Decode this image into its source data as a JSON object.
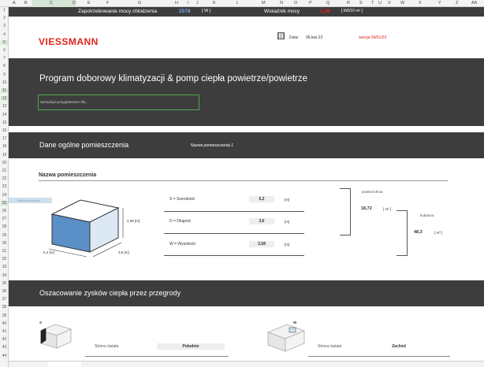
{
  "columns": [
    "A",
    "B",
    "C",
    "D",
    "E",
    "F",
    "G",
    "H",
    "I",
    "J",
    "K",
    "L",
    "M",
    "N",
    "O",
    "P",
    "Q",
    "R",
    "S",
    "T",
    "U",
    "V",
    "W",
    "X",
    "Y",
    "Z",
    "AA"
  ],
  "rows": [
    "1",
    "2",
    "3",
    "4",
    "5",
    "6",
    "7",
    "8",
    "9",
    "10",
    "11",
    "12",
    "13",
    "14",
    "15",
    "16",
    "17",
    "18",
    "19",
    "20",
    "21",
    "22",
    "23",
    "24",
    "25",
    "26",
    "27",
    "28",
    "29",
    "30",
    "31",
    "32",
    "33",
    "34",
    "35",
    "36",
    "37",
    "38",
    "39",
    "40",
    "41",
    "42",
    "43",
    "44"
  ],
  "topbar": {
    "demand_label": "Zapotrzebowanie mocy chłodzenia",
    "demand_value": "2578",
    "demand_unit": "[ W ]",
    "index_label": "Wskaźnik mocy",
    "index_value": "1,36",
    "index_unit": "[ kW/10 m² ]"
  },
  "header": {
    "logo": "VIESSMANN",
    "date_label": "Data:",
    "date_value": "06.kwi.23",
    "version": "wersja 04/01/23"
  },
  "banner": {
    "title": "Program doborowy klimatyzacji & pomp ciepła powietrze/powietrze",
    "sim_placeholder": "Symulacja przygotowano dla..."
  },
  "general": {
    "heading": "Dane ogólne pomieszczenia",
    "room_name_value": "Nazwa pomieszczenia 1"
  },
  "room": {
    "title": "Nazwa pomieszczenia",
    "side_label": "Naciśnij przycisk",
    "box_height": "2,58 [m]",
    "box_width": "5,2 [m]",
    "box_depth": "3,6 [m]",
    "dims": [
      {
        "label": "S = Szerokość",
        "value": "5,2",
        "unit": "[m]"
      },
      {
        "label": "D = Długość",
        "value": "3,6",
        "unit": "[m]"
      },
      {
        "label": "W = Wysokość",
        "value": "2,58",
        "unit": "[m]"
      }
    ],
    "area_label": "powierzchnia",
    "area_value": "18,72",
    "area_unit": "[ m² ]",
    "volume_label": "kubatura",
    "volume_value": "48,3",
    "volume_unit": "[ m³ ]"
  },
  "gains": {
    "heading": "Oszacowanie zysków ciepła przez przegrody",
    "walls": [
      {
        "letter": "S",
        "strona_label": "Strona świata",
        "value": "Południe"
      },
      {
        "letter": "W",
        "strona_label": "Strona świata",
        "value": "Zachód"
      }
    ]
  },
  "colors": {
    "dark": "#3d3d3d",
    "brand_red": "#e2231a",
    "demand_blue": "#6fa8dc",
    "selection_green": "#4ea84e"
  }
}
